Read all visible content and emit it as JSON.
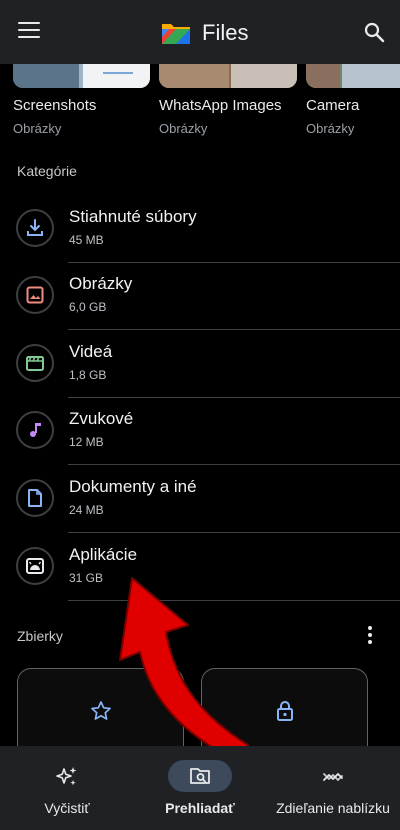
{
  "app": {
    "title": "Files"
  },
  "folders": [
    {
      "name": "Screenshots",
      "sub": "Obrázky"
    },
    {
      "name": "WhatsApp Images",
      "sub": "Obrázky"
    },
    {
      "name": "Camera",
      "sub": "Obrázky"
    }
  ],
  "categories_title": "Kategórie",
  "categories": [
    {
      "name": "Stiahnuté súbory",
      "size": "45 MB",
      "icon": "download-icon"
    },
    {
      "name": "Obrázky",
      "size": "6,0 GB",
      "icon": "image-icon"
    },
    {
      "name": "Videá",
      "size": "1,8 GB",
      "icon": "video-icon"
    },
    {
      "name": "Zvukové",
      "size": "12 MB",
      "icon": "music-note-icon"
    },
    {
      "name": "Dokumenty a iné",
      "size": "24 MB",
      "icon": "document-icon"
    },
    {
      "name": "Aplikácie",
      "size": "31 GB",
      "icon": "android-icon"
    }
  ],
  "collections_title": "Zbierky",
  "collections": [
    {
      "icon": "star-icon"
    },
    {
      "icon": "lock-icon"
    }
  ],
  "nav": [
    {
      "label": "Vyčistiť",
      "icon": "sparkle-icon",
      "active": false
    },
    {
      "label": "Prehliadať",
      "icon": "browse-icon",
      "active": true
    },
    {
      "label": "Zdieľanie nablízku",
      "icon": "nearby-share-icon",
      "active": false
    }
  ],
  "colors": {
    "background": "#000000",
    "app_bar": "#202124",
    "accent_blue": "#8ab4f8",
    "annotation_arrow": "#e00000"
  }
}
